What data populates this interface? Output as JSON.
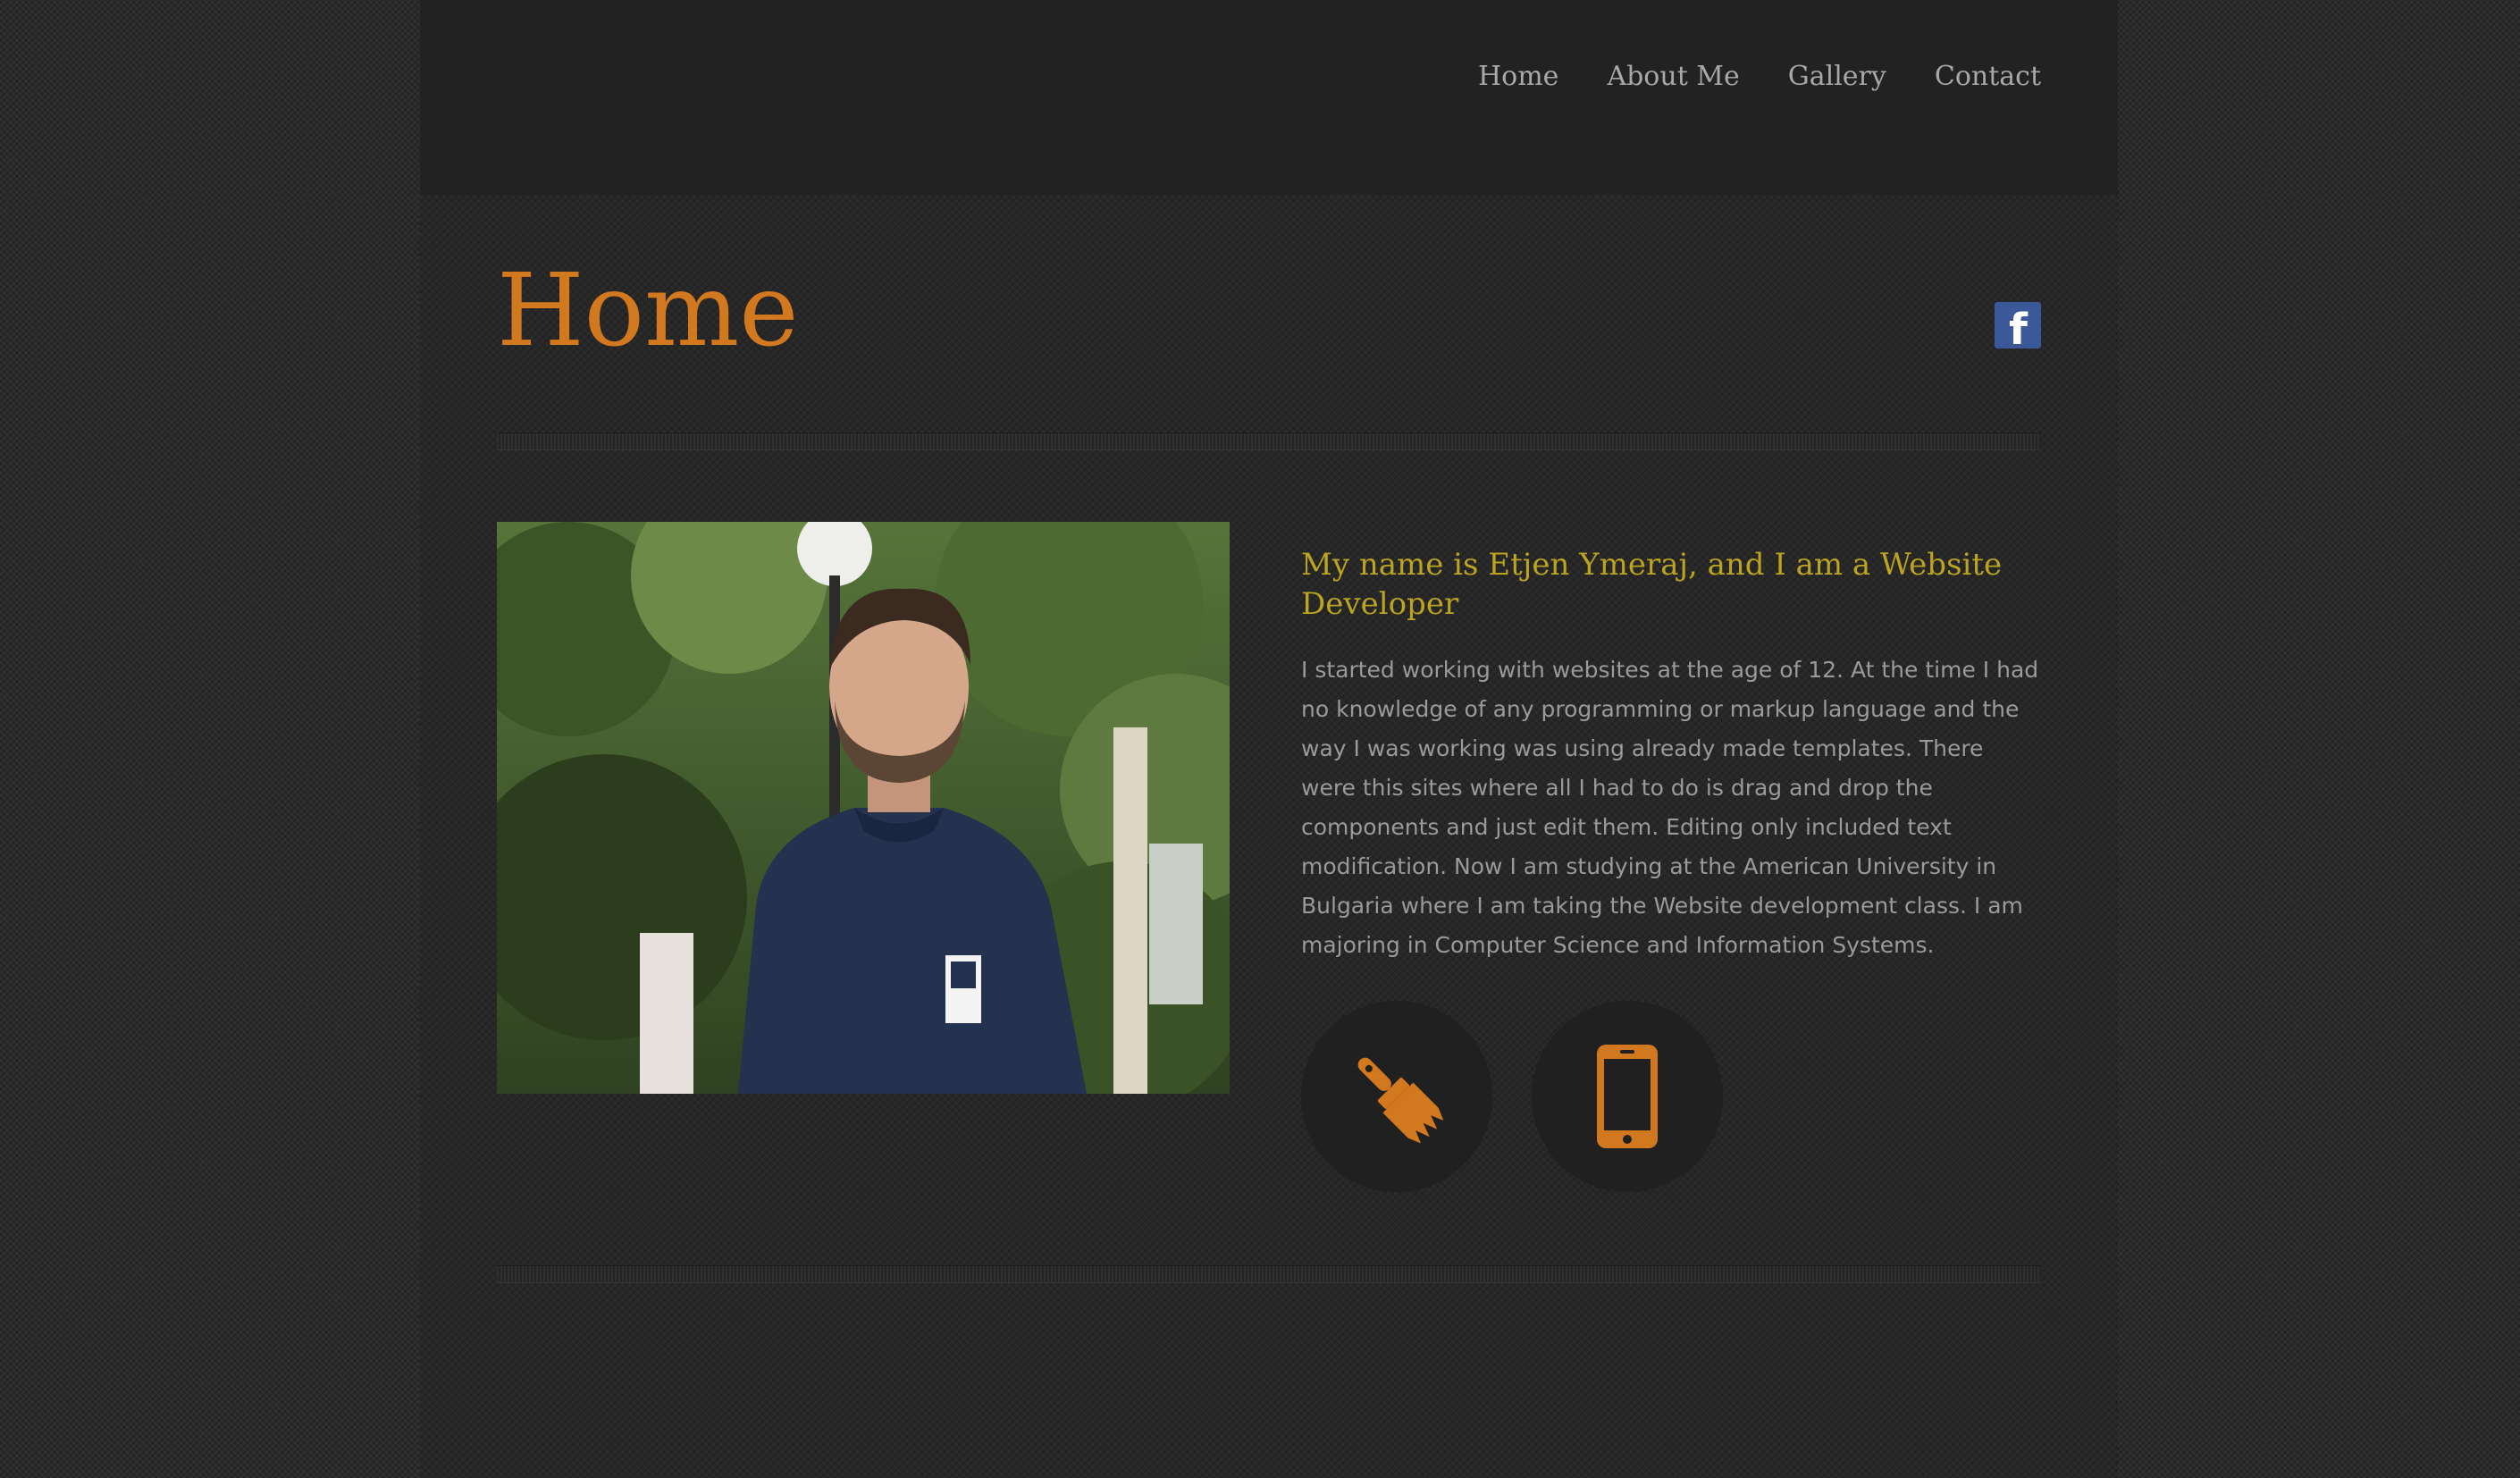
{
  "nav": {
    "items": [
      {
        "label": "Home"
      },
      {
        "label": "About Me"
      },
      {
        "label": "Gallery"
      },
      {
        "label": "Contact"
      }
    ]
  },
  "page": {
    "title": "Home"
  },
  "social": {
    "facebook_glyph": "f",
    "icon": "facebook-icon"
  },
  "intro": {
    "heading": "My name is Etjen Ymeraj, and I am a Website Developer",
    "body": "I started working with websites at the age of 12. At the time I had no knowledge of any programming or markup language and the way I was working was using already made templates. There were this sites where all I had to do is drag and drop the components and just edit them. Editing only included text modification. Now I am studying at the American University in Bulgaria where I am taking the Website development class. I am majoring in Computer Science and Information Systems."
  },
  "skills": [
    {
      "icon": "paintbrush-icon"
    },
    {
      "icon": "smartphone-icon"
    }
  ],
  "colors": {
    "accent": "#d2781f",
    "heading": "#bca420",
    "facebook": "#3b5998",
    "nav_text": "#a8a8a8",
    "body_text": "#9a9a9a"
  }
}
